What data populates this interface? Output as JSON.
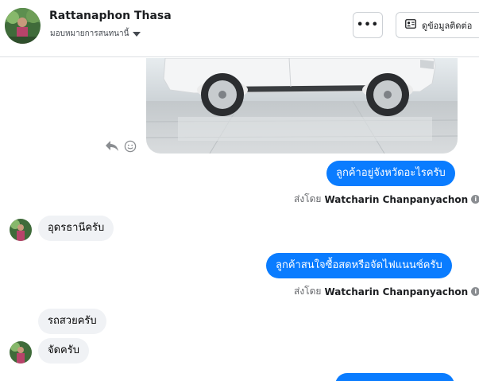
{
  "header": {
    "contact_name": "Rattanaphon Thasa",
    "assign_label": "มอบหมายการสนทนานี้",
    "more_label": "•••",
    "contact_info_label": "ดูข้อมูลติดต่อ"
  },
  "messages": {
    "out_1": "ลูกค้าอยู่จังหวัดอะไรครับ",
    "in_1": "อุดรธานีครับ",
    "out_2": "ลูกค้าสนใจซื้อสดหรือจัดไฟแนนซ์ครับ",
    "in_2": "รถสวยครับ",
    "in_3": "จัดครับ"
  },
  "sent_by": {
    "prefix": "ส่งโดย",
    "name": "Watcharin Chanpanyachon"
  },
  "icons": {
    "more": "more-dots-icon",
    "contact_card": "contact-card-icon",
    "reply": "reply-icon",
    "react": "smiley-icon",
    "info": "info-icon",
    "caret": "caret-down-icon"
  },
  "colors": {
    "outgoing_bubble": "#0a7cff",
    "incoming_bubble": "#f0f2f5"
  }
}
